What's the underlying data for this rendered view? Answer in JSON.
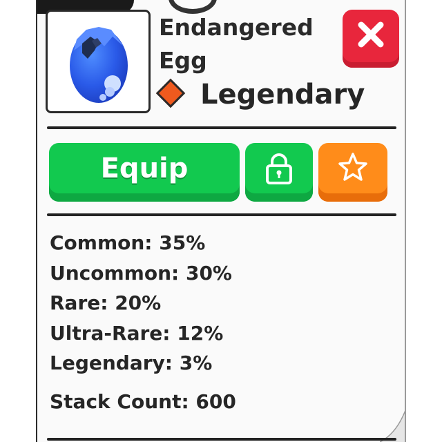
{
  "item": {
    "name": "Endangered Egg",
    "rarity": "Legendary",
    "rarity_color": "#ef5a1e",
    "icon": "blue-egg-icon"
  },
  "buttons": {
    "equip_label": "Equip",
    "lock_icon": "lock-icon",
    "favorite_icon": "star-icon",
    "close_icon": "close-icon",
    "equip_color": "#12c94f",
    "favorite_color": "#ff8c1a",
    "close_color": "#e8263c"
  },
  "odds": [
    {
      "text": "Common: 35%"
    },
    {
      "text": "Uncommon: 30%"
    },
    {
      "text": "Rare: 20%"
    },
    {
      "text": "Ultra-Rare: 12%"
    },
    {
      "text": "Legendary: 3%"
    }
  ],
  "stack": {
    "text": "Stack Count: 600"
  }
}
